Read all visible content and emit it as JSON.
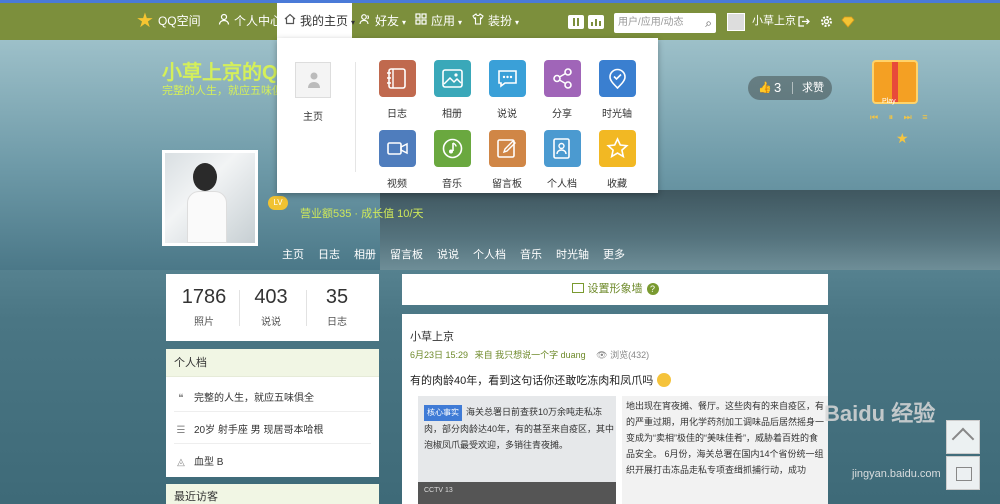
{
  "topnav": {
    "logo": "QQ空间",
    "user_center": "个人中心",
    "my_home": "我的主页",
    "friends": "好友",
    "apps": "应用",
    "dress": "装扮",
    "search_placeholder": "用户/应用/动态",
    "username": "小草上京"
  },
  "header": {
    "title": "小草上京的Q",
    "subtitle": "完整的人生，就应五味俱",
    "level_text": "营业额535 · 成长值 10/天",
    "likes": "3",
    "beg_like": "求赞",
    "gift_label": "Play",
    "player_text": "⏮ ⏸ ⏭ ≡"
  },
  "subnav": [
    "主页",
    "日志",
    "相册",
    "留言板",
    "说说",
    "个人档",
    "音乐",
    "时光轴",
    "更多"
  ],
  "dropdown": {
    "home": "主页",
    "apps": [
      {
        "label": "日志",
        "color": "#c0694e",
        "icon": "notebook-icon"
      },
      {
        "label": "相册",
        "color": "#3aa8b9",
        "icon": "photo-icon"
      },
      {
        "label": "说说",
        "color": "#3aa0d8",
        "icon": "chat-icon"
      },
      {
        "label": "分享",
        "color": "#a065b8",
        "icon": "share-icon"
      },
      {
        "label": "时光轴",
        "color": "#3a7fd0",
        "icon": "timeline-icon"
      },
      {
        "label": "视频",
        "color": "#4f7dbd",
        "icon": "video-icon"
      },
      {
        "label": "音乐",
        "color": "#6aa83f",
        "icon": "music-icon"
      },
      {
        "label": "留言板",
        "color": "#d08646",
        "icon": "board-icon"
      },
      {
        "label": "个人档",
        "color": "#4b9ad0",
        "icon": "profile-icon"
      },
      {
        "label": "收藏",
        "color": "#f2b823",
        "icon": "star-icon"
      }
    ]
  },
  "stats": [
    {
      "value": "1786",
      "label": "照片"
    },
    {
      "value": "403",
      "label": "说说"
    },
    {
      "value": "35",
      "label": "日志"
    }
  ],
  "profile": {
    "title": "个人档",
    "rows": [
      {
        "icon": "quote-icon",
        "text": "完整的人生，就应五味俱全"
      },
      {
        "icon": "card-icon",
        "text": "20岁  射手座  男  现居哥本哈根"
      },
      {
        "icon": "blood-icon",
        "text": "血型 B"
      }
    ]
  },
  "visitors": {
    "title": "最近访客"
  },
  "setbar": {
    "label": "设置形象墙",
    "help": "?"
  },
  "post": {
    "author": "小草上京",
    "date": "6月23日 15:29",
    "source": "来自 我只想说一个字 duang",
    "views": "浏览(432)",
    "text": "有的肉龄40年，看到这句话你还敢吃冻肉和凤爪吗",
    "news_tag": "核心事实",
    "news_left": "海关总署日前查获10万余吨走私冻肉，部分肉龄达40年，有的甚至来自疫区，其中泡椒凤爪最受欢迎，多销往青夜摊。",
    "news_video": "CCTV 13",
    "news_right": "地出现在宵夜摊、餐厅。这些肉有的来自疫区，有的严重过期，用化学药剂加工调味品后居然摇身一变成为“卖相”极佳的“美味佳肴”，威胁着百姓的食品安全。 6月份，海关总署在国内14个省份统一组织开展打击冻品走私专项查缉抓捕行动，成功"
  },
  "watermark": {
    "main": "Baidu 经验",
    "sub": "jingyan.baidu.com"
  }
}
